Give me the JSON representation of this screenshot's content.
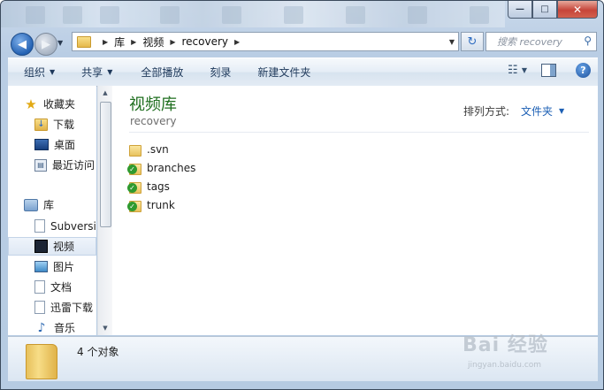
{
  "window": {
    "controls": {
      "minimize": "—",
      "maximize": "□",
      "close": "✕"
    }
  },
  "address_bar": {
    "breadcrumbs": [
      "库",
      "视频",
      "recovery"
    ],
    "search_placeholder": "搜索 recovery"
  },
  "toolbar": {
    "organize": "组织",
    "share": "共享",
    "play_all": "全部播放",
    "burn": "刻录",
    "new_folder": "新建文件夹"
  },
  "nav_pane": {
    "favorites": {
      "label": "收藏夹",
      "items": [
        "下载",
        "桌面",
        "最近访问"
      ]
    },
    "libraries": {
      "label": "库",
      "items": [
        "Subversi",
        "视频",
        "图片",
        "文档",
        "迅雷下载",
        "音乐"
      ]
    },
    "selected": "视频"
  },
  "content": {
    "library_title": "视频库",
    "library_subtitle": "recovery",
    "arrange_label": "排列方式:",
    "arrange_value": "文件夹",
    "files": [
      {
        "name": ".svn",
        "icon": "folder-icon"
      },
      {
        "name": "branches",
        "icon": "svn-folder-icon"
      },
      {
        "name": "tags",
        "icon": "svn-folder-icon"
      },
      {
        "name": "trunk",
        "icon": "svn-folder-icon"
      }
    ]
  },
  "details_pane": {
    "count": "4 个对象"
  },
  "watermark": {
    "main": "Bai 经验",
    "sub": "jingyan.baidu.com"
  },
  "colors": {
    "accent": "#1c5fb4",
    "library_title": "#1e6e1e"
  }
}
